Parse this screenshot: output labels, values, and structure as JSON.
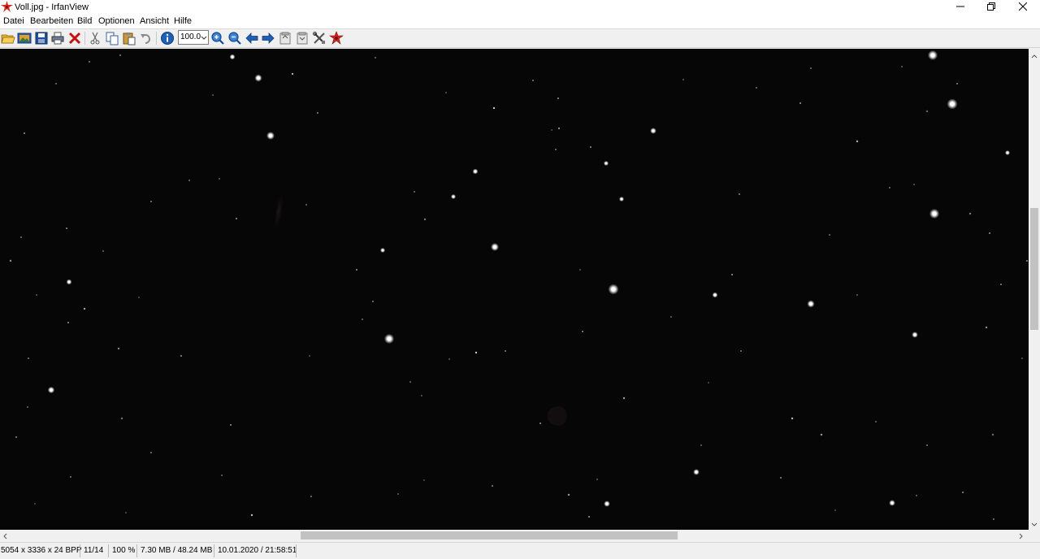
{
  "window": {
    "title": "Voll.jpg - IrfanView",
    "controls": [
      "minimize-icon",
      "restore-icon",
      "close-icon"
    ]
  },
  "menu": [
    "Datei",
    "Bearbeiten",
    "Bild",
    "Optionen",
    "Ansicht",
    "Hilfe"
  ],
  "toolbar": {
    "icons": [
      "open-folder-icon",
      "thumbnails-icon",
      "save-icon",
      "print-icon",
      "delete-icon",
      "cut-icon",
      "copy-icon",
      "paste-icon",
      "undo-icon",
      "info-icon",
      "zoom-in-icon",
      "zoom-out-icon",
      "previous-icon",
      "next-icon",
      "first-page-icon",
      "last-page-icon",
      "settings-icon",
      "irfanview-icon"
    ],
    "zoom_value": "100.0"
  },
  "image": {
    "description_colors": {
      "background": "#070607",
      "star": "#ffffff"
    }
  },
  "status": {
    "dimensions": "5054 x 3336 x 24 BPP",
    "index": "11/14",
    "zoom": "100 %",
    "size": "7.30 MB / 48.24 MB",
    "datetime": "10.01.2020 / 21:58:51"
  }
}
